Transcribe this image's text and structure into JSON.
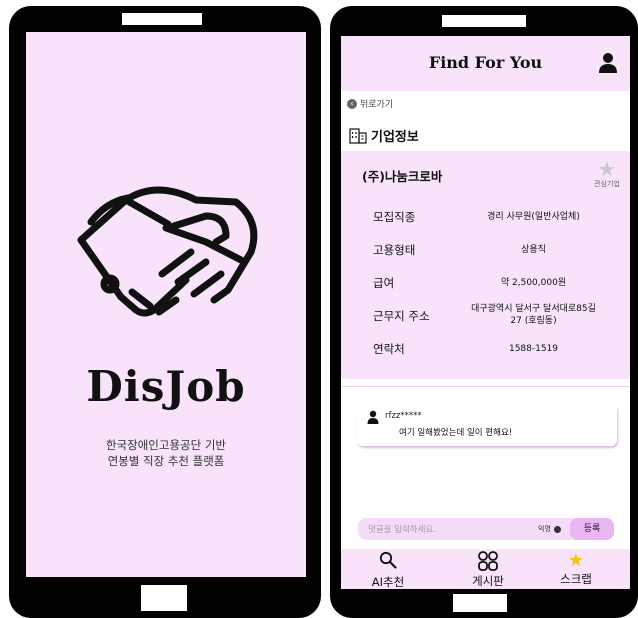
{
  "splash": {
    "brand": "DisJob",
    "tagline_line1": "한국장애인고용공단 기반",
    "tagline_line2": "연봉별 직장 추천 플랫폼",
    "logo_icon": "handshake-icon"
  },
  "detail": {
    "app_title": "Find For You",
    "back_label": "뒤로가기",
    "section_title": "기업정보",
    "company": {
      "name": "(주)나눔크로바",
      "favorite_label": "관심기업"
    },
    "info": [
      {
        "label": "모집직종",
        "value": "경리 사무원(일반사업체)"
      },
      {
        "label": "고용형태",
        "value": "상용직"
      },
      {
        "label": "급여",
        "value": "약 2,500,000원"
      },
      {
        "label": "근무지 주소",
        "value_line1": "대구광역시 달서구 달서대로85길",
        "value_line2": "27 (호림동)"
      },
      {
        "label": "연락처",
        "value": "1588-1519"
      }
    ],
    "comment": {
      "user": "rfzz*****",
      "text": "여기 일해봤었는데 일이 편해요!"
    },
    "input": {
      "placeholder": "댓글을 입력하세요.",
      "anonymous_label": "익명",
      "submit_label": "등록"
    },
    "tabs": [
      {
        "label": "AI추천",
        "icon": "search-icon"
      },
      {
        "label": "게시판",
        "icon": "grid-icon"
      },
      {
        "label": "스크랩",
        "icon": "star-icon"
      }
    ]
  },
  "colors": {
    "pink_background": "#f8e3fb",
    "button_pink": "#e9b6f3",
    "star_gold": "#f2c40f"
  }
}
